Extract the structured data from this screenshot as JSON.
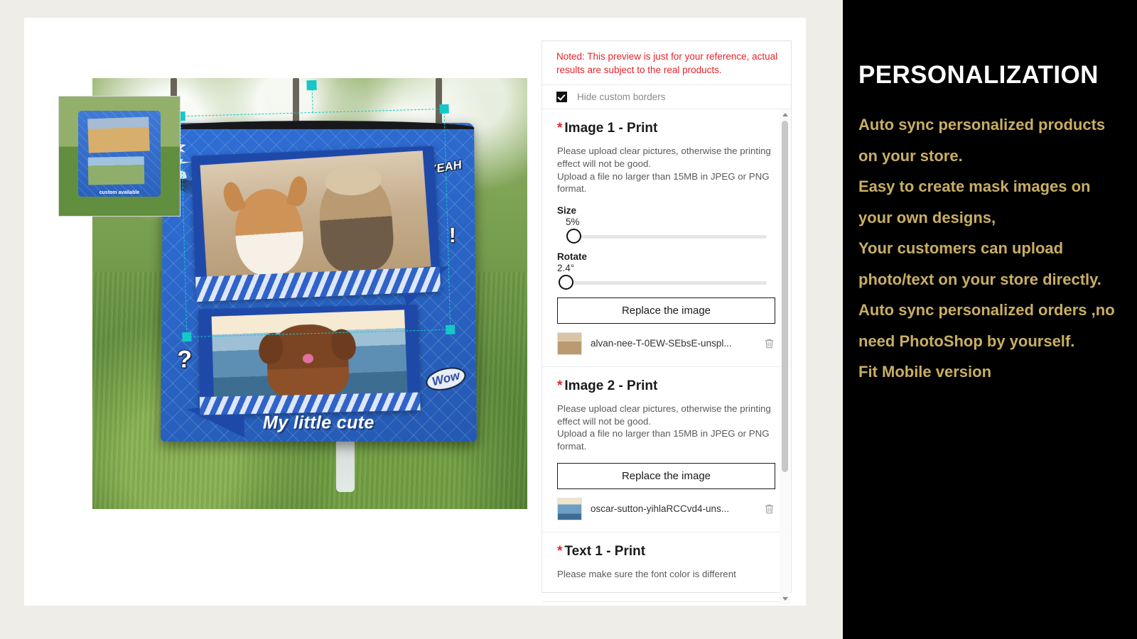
{
  "preview": {
    "product_caption": "My little cute",
    "thumbnail_caption": "custom available",
    "decorations": {
      "yeah": "YEAH",
      "question": "?",
      "exclaim": "!",
      "wow": "Wow"
    },
    "selection": {
      "handle_color": "#15c8c8",
      "outline_style": "dashed"
    }
  },
  "panel": {
    "notice": "Noted: This preview is just for your reference, actual results are subject to the real products.",
    "notice_color": "#e8232a",
    "hide_borders_label": "Hide custom borders",
    "hide_borders_checked": true,
    "sections": [
      {
        "required_marker": "*",
        "title": "Image 1 - Print",
        "hint": "Please upload clear pictures, otherwise the printing effect will not be good.\nUpload a file no larger than 15MB in JPEG or PNG format.",
        "size_label": "Size",
        "size_value": "5%",
        "size_percent": 5,
        "rotate_label": "Rotate",
        "rotate_value": "2.4°",
        "rotate_percent": 2,
        "button_label": "Replace the image",
        "file_name": "alvan-nee-T-0EW-SEbsE-unspl...",
        "delete_icon": "trash-icon"
      },
      {
        "required_marker": "*",
        "title": "Image 2 - Print",
        "hint": "Please upload clear pictures, otherwise the printing effect will not be good.\nUpload a file no larger than 15MB in JPEG or PNG format.",
        "button_label": "Replace the image",
        "file_name": "oscar-sutton-yihlaRCCvd4-uns...",
        "delete_icon": "trash-icon"
      },
      {
        "required_marker": "*",
        "title": "Text 1 - Print",
        "hint": "Please make sure the font color is different"
      }
    ],
    "scrollbar": {
      "up_icon": "chevron-up-icon",
      "down_icon": "chevron-down-icon"
    }
  },
  "promo": {
    "heading": "PERSONALIZATION",
    "accent_color": "#c9ae63",
    "background_color": "#000000",
    "bullets": [
      "Auto sync personalized products on your store.",
      "Easy to create mask images on your own designs,",
      "Your customers can upload photo/text on your store directly.",
      "Auto sync personalized orders ,no need PhotoShop by yourself.",
      "Fit Mobile version"
    ]
  }
}
